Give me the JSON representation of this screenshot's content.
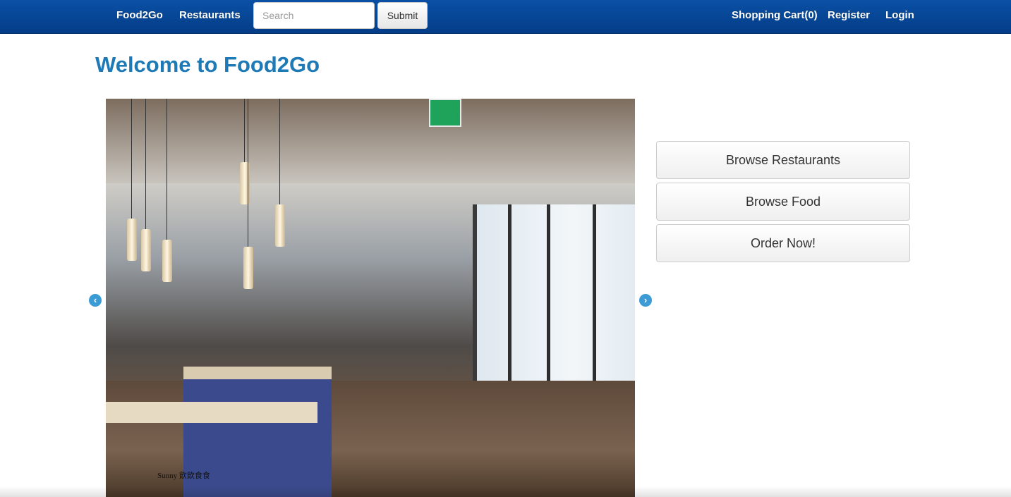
{
  "navbar": {
    "brand": "Food2Go",
    "restaurants_link": "Restaurants",
    "search_placeholder": "Search",
    "submit_label": "Submit",
    "cart_link": "Shopping Cart(0)",
    "register_link": "Register",
    "login_link": "Login"
  },
  "main": {
    "title": "Welcome to Food2Go",
    "carousel": {
      "caption": "Sunny 飲飲食食",
      "prev_icon": "chevron-left-icon",
      "next_icon": "chevron-right-icon"
    },
    "actions": {
      "browse_restaurants": "Browse Restaurants",
      "browse_food": "Browse Food",
      "order_now": "Order Now!"
    }
  },
  "colors": {
    "navbar_top": "#0a50a5",
    "navbar_bottom": "#043d88",
    "title": "#1d7ab6",
    "arrow": "#3a9bd5"
  }
}
